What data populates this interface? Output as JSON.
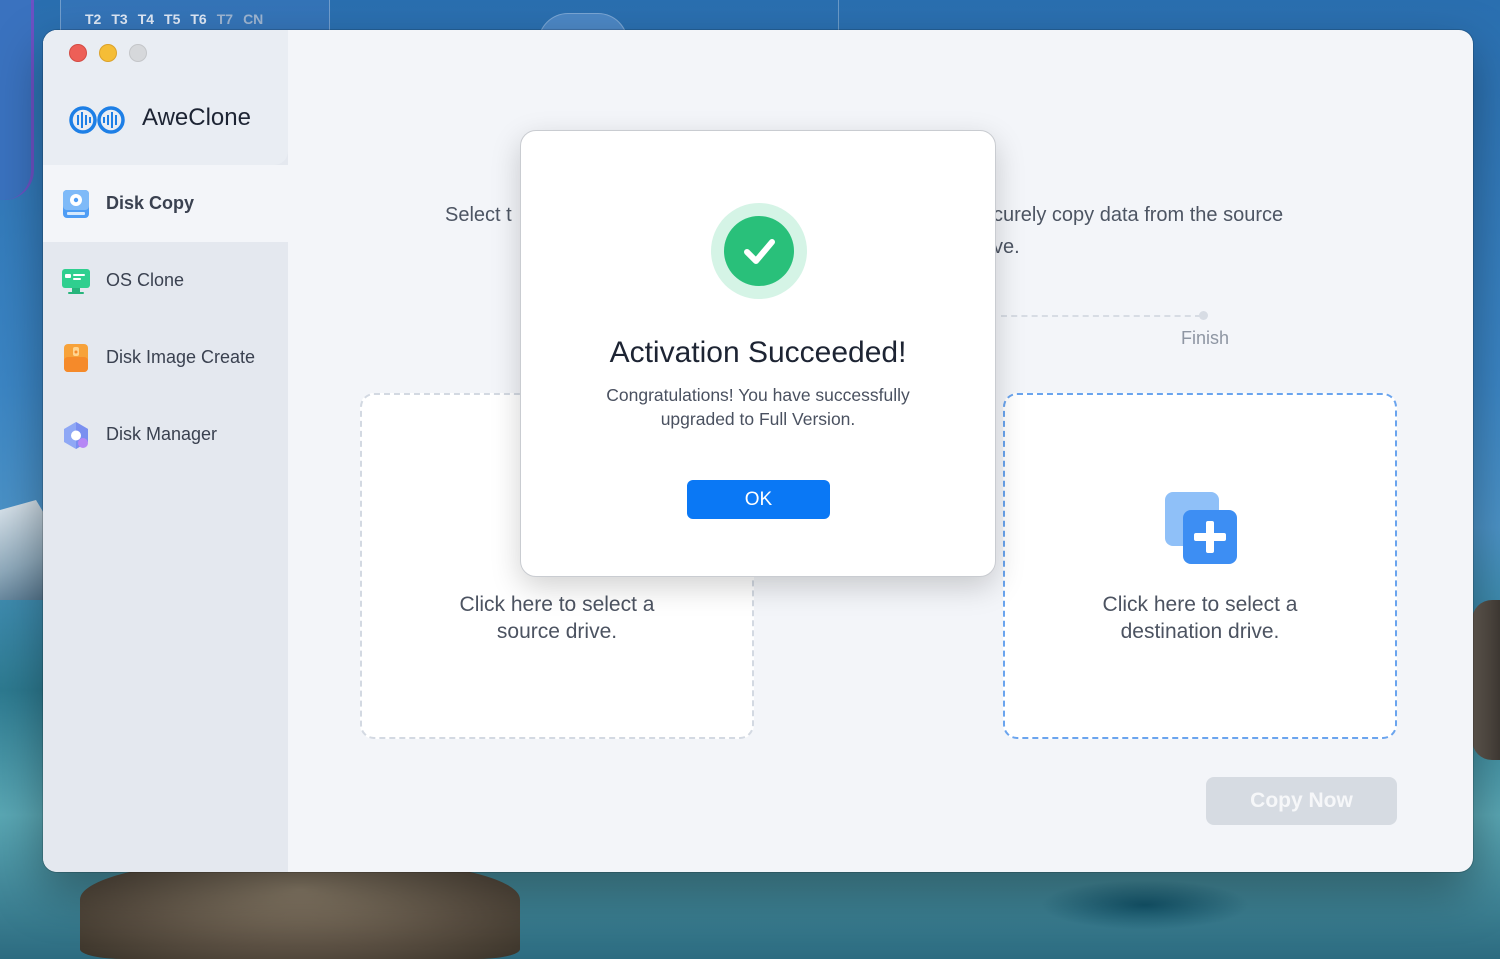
{
  "desktop": {
    "top_tabs": [
      "T2",
      "T3",
      "T4",
      "T5",
      "T6",
      "T7",
      "CN"
    ]
  },
  "app": {
    "name": "AweClone"
  },
  "sidebar": {
    "items": [
      {
        "label": "Disk Copy",
        "icon": "disk-copy-icon",
        "active": true
      },
      {
        "label": "OS Clone",
        "icon": "os-clone-icon",
        "active": false
      },
      {
        "label": "Disk Image Create",
        "icon": "disk-image-icon",
        "active": false
      },
      {
        "label": "Disk Manager",
        "icon": "disk-manager-icon",
        "active": false
      }
    ]
  },
  "main": {
    "description_start": "Select t",
    "description_end_line1": "curely copy data from the source",
    "description_end_line2": "ve.",
    "step_finish": "Finish",
    "source_text_line1": "Click here to select a",
    "source_text_line2": "source drive.",
    "dest_text_line1": "Click here to select a",
    "dest_text_line2": "destination drive.",
    "copy_button": "Copy Now"
  },
  "dialog": {
    "title": "Activation Succeeded!",
    "message_line1": "Congratulations! You have successfully",
    "message_line2": "upgraded to Full Version.",
    "ok_button": "OK"
  },
  "colors": {
    "accent": "#0a78f5",
    "success": "#29c07a",
    "dest_border": "#6aa4ee"
  }
}
